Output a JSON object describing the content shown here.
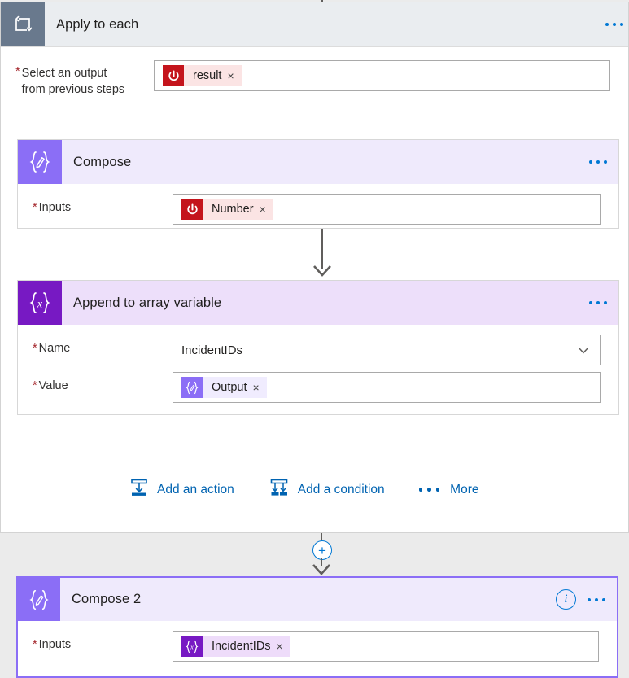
{
  "loop": {
    "title": "Apply to each",
    "icon": "loop-icon",
    "menu_icon": "ellipsis-icon",
    "select_output": {
      "label": "Select an output from previous steps",
      "label_line1": "Select an output",
      "label_line2": "from previous steps",
      "required": true,
      "token": {
        "label": "result",
        "icon": "power-button-icon",
        "remove": "×"
      }
    }
  },
  "compose": {
    "title": "Compose",
    "icon": "compose-braces-pencil-icon",
    "menu_icon": "ellipsis-icon",
    "inputs": {
      "label": "Inputs",
      "required": true,
      "token": {
        "label": "Number",
        "icon": "power-button-icon",
        "remove": "×"
      }
    }
  },
  "append": {
    "title": "Append to array variable",
    "icon": "variable-braces-x-icon",
    "menu_icon": "ellipsis-icon",
    "name_field": {
      "label": "Name",
      "required": true,
      "value": "IncidentIDs",
      "dropdown_icon": "chevron-down-icon"
    },
    "value_field": {
      "label": "Value",
      "required": true,
      "token": {
        "label": "Output",
        "icon": "compose-braces-pencil-icon",
        "remove": "×"
      }
    }
  },
  "actions": {
    "add_action": {
      "label": "Add an action",
      "icon": "add-action-icon"
    },
    "add_condition": {
      "label": "Add a condition",
      "icon": "add-condition-icon"
    },
    "more": {
      "label": "More",
      "icon": "ellipsis-icon"
    }
  },
  "connector": {
    "plus_label": "+",
    "plus_icon": "add-step-plus-icon"
  },
  "compose2": {
    "title": "Compose 2",
    "icon": "compose-braces-pencil-icon",
    "info_icon": "info-icon",
    "info_label": "i",
    "menu_icon": "ellipsis-icon",
    "selected": true,
    "inputs": {
      "label": "Inputs",
      "required": true,
      "token": {
        "label": "IncidentIDs",
        "icon": "variable-braces-x-icon",
        "remove": "×"
      }
    }
  },
  "colors": {
    "canvas": "#ebebeb",
    "loop_header": "#eaedf0",
    "loop_icon": "#69798d",
    "compose_icon": "#8b6ef6",
    "compose_header": "#efeafc",
    "variable_icon": "#7719c3",
    "variable_header": "#eddffa",
    "token_red": "#c4141c",
    "token_red_bg": "#fbe4e4",
    "link_blue": "#0063b1",
    "accent_blue": "#0078d4",
    "required_red": "#a4262c",
    "connector_gray": "#605e5c"
  }
}
